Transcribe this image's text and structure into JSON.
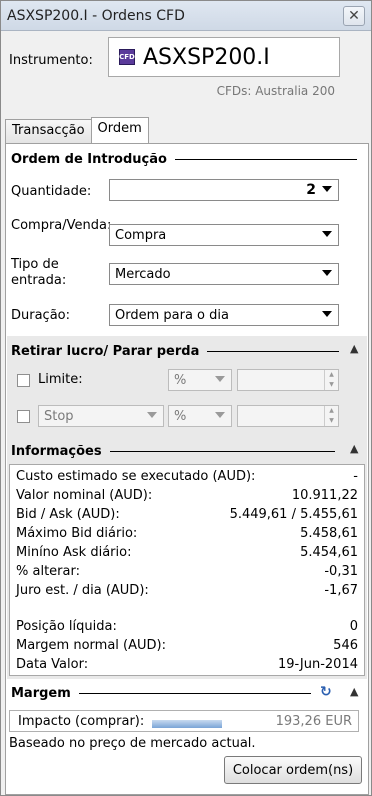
{
  "window": {
    "title": "ASXSP200.I - Ordens CFD",
    "close_label": "✕"
  },
  "instrument": {
    "label": "Instrumento:",
    "icon_text": "CFD",
    "name": "ASXSP200.I",
    "subtitle": "CFDs: Australia 200"
  },
  "tabs": [
    {
      "label": "Transacção",
      "active": false
    },
    {
      "label": "Ordem",
      "active": true
    }
  ],
  "order_entry": {
    "heading": "Ordem de Introdução",
    "quantity_label": "Quantidade:",
    "quantity_value": "2",
    "buysell_label": "Compra/Venda:",
    "buysell_value": "Compra",
    "entry_type_label": "Tipo de entrada:",
    "entry_type_value": "Mercado",
    "duration_label": "Duração:",
    "duration_value": "Ordem para o dia"
  },
  "take_profit": {
    "heading": "Retirar lucro/ Parar perda",
    "limit_label": "Limite:",
    "limit_unit": "%",
    "stop_label": "Stop",
    "stop_unit": "%"
  },
  "info": {
    "heading": "Informações",
    "rows": [
      {
        "label": "Custo estimado se executado (AUD):",
        "value": "-"
      },
      {
        "label": "Valor nominal (AUD):",
        "value": "10.911,22"
      },
      {
        "label": "Bid / Ask (AUD):",
        "value": "5.449,61 / 5.455,61"
      },
      {
        "label": "Máximo Bid diário:",
        "value": "5.458,61"
      },
      {
        "label": "Miníno Ask diário:",
        "value": "5.454,61"
      },
      {
        "label": "% alterar:",
        "value": "-0,31"
      },
      {
        "label": "Juro est. / dia (AUD):",
        "value": "-1,67"
      },
      {
        "label": "Posição líquida:",
        "value": "0"
      },
      {
        "label": "Margem normal (AUD):",
        "value": "546"
      },
      {
        "label": "Data Valor:",
        "value": "19-Jun-2014"
      }
    ]
  },
  "margin": {
    "heading": "Margem",
    "impact_label": "Impacto (comprar):",
    "impact_value": "193,26 EUR",
    "note": "Baseado no preço de mercado actual."
  },
  "place_button": "Colocar ordem(ns)",
  "colors": {
    "accent_progress": "#7aa4d6",
    "title_bar": "#cfd9e6"
  }
}
